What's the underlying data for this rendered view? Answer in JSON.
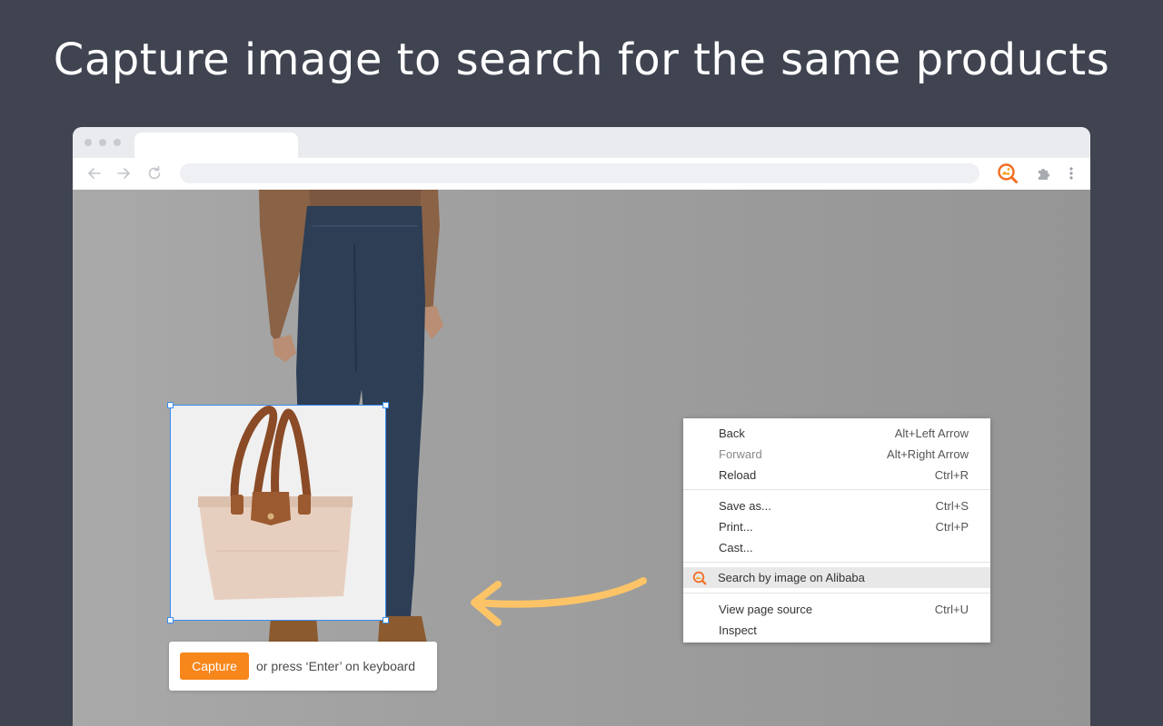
{
  "headline": "Capture image to search for the same products",
  "capture": {
    "button_label": "Capture",
    "hint": "or press ‘Enter’ on keyboard"
  },
  "context_menu": {
    "items": [
      {
        "label": "Back",
        "shortcut": "Alt+Left Arrow"
      },
      {
        "label": "Forward",
        "shortcut": "Alt+Right Arrow"
      },
      {
        "label": "Reload",
        "shortcut": "Ctrl+R"
      },
      {
        "label": "Save as...",
        "shortcut": "Ctrl+S"
      },
      {
        "label": "Print...",
        "shortcut": "Ctrl+P"
      },
      {
        "label": "Cast..."
      },
      {
        "label": "Search by image on Alibaba"
      },
      {
        "label": "View page source",
        "shortcut": "Ctrl+U"
      },
      {
        "label": "Inspect"
      }
    ]
  },
  "icons": {
    "back": "arrow-left-icon",
    "forward": "arrow-right-icon",
    "reload": "reload-icon",
    "extension": "image-search-icon",
    "extensions_menu": "puzzle-icon",
    "more": "kebab-menu-icon"
  },
  "colors": {
    "background": "#3f4450",
    "accent": "#f7861b",
    "selection": "#3b8df0",
    "arrow": "#fcc467"
  }
}
